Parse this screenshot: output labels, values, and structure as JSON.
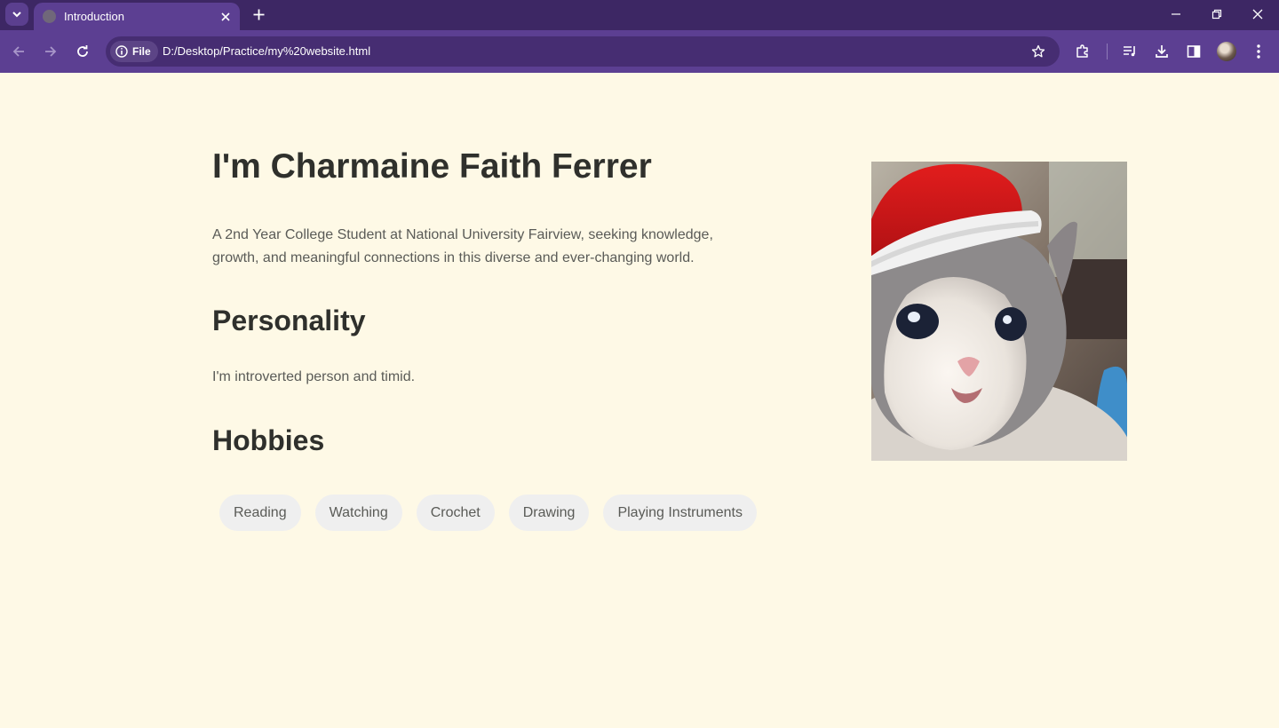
{
  "browser": {
    "tab_title": "Introduction",
    "site_chip": "File",
    "url": "D:/Desktop/Practice/my%20website.html"
  },
  "page": {
    "heading": "I'm Charmaine Faith Ferrer",
    "bio": "A 2nd Year College Student at National University Fairview, seeking knowledge, growth, and meaningful connections in this diverse and ever-changing world.",
    "personality_heading": "Personality",
    "personality_text": "I'm introverted person and timid.",
    "hobbies_heading": "Hobbies",
    "hobbies": [
      "Reading",
      "Watching",
      "Crochet",
      "Drawing",
      "Playing Instruments"
    ]
  },
  "colors": {
    "page_background": "#fef9e6",
    "browser_frame": "#5c3f92",
    "tab_strip": "#3d2764",
    "heading_text": "#2f302c",
    "body_text": "#5a5b57",
    "pill_background": "#efefef"
  },
  "icons": [
    "tab-search-icon",
    "globe-favicon-icon",
    "close-icon",
    "plus-icon",
    "minimize-icon",
    "restore-icon",
    "back-icon",
    "forward-icon",
    "reload-icon",
    "info-icon",
    "star-icon",
    "extensions-icon",
    "media-control-icon",
    "download-icon",
    "side-panel-icon",
    "menu-icon"
  ]
}
